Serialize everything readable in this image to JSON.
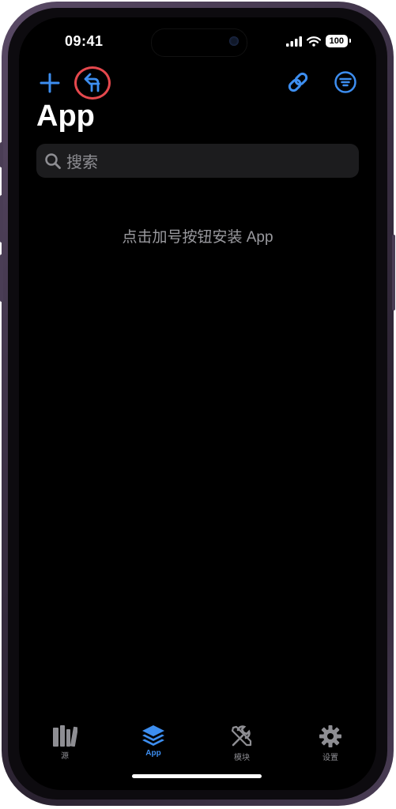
{
  "status_bar": {
    "time": "09:41",
    "battery": "100"
  },
  "toolbar": {
    "left_icons": [
      "plus-icon",
      "merge-arrow-icon"
    ],
    "right_icons": [
      "link-icon",
      "filter-menu-icon"
    ],
    "accent_color": "#3d8ef0",
    "highlight_color": "#e5484d"
  },
  "header": {
    "title": "App"
  },
  "search": {
    "placeholder": "搜索"
  },
  "empty_state": {
    "message": "点击加号按钮安装 App"
  },
  "tab_bar": {
    "tabs": [
      {
        "label": "源",
        "icon": "books-icon",
        "active": false
      },
      {
        "label": "App",
        "icon": "layers-icon",
        "active": true
      },
      {
        "label": "模块",
        "icon": "tools-icon",
        "active": false
      },
      {
        "label": "设置",
        "icon": "gear-icon",
        "active": false
      }
    ]
  }
}
